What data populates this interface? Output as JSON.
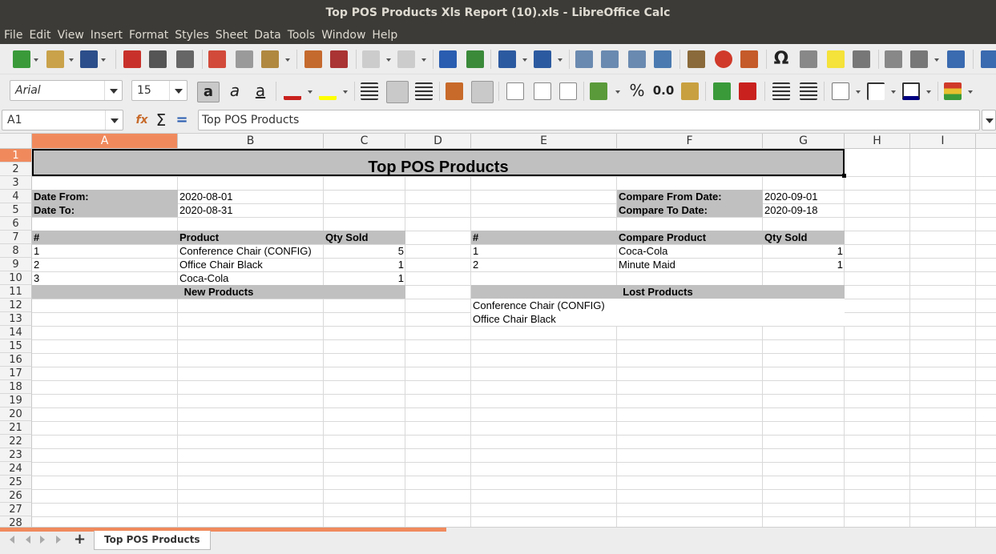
{
  "window": {
    "title": "Top POS Products Xls Report (10).xls - LibreOffice Calc"
  },
  "menu": [
    "File",
    "Edit",
    "View",
    "Insert",
    "Format",
    "Styles",
    "Sheet",
    "Data",
    "Tools",
    "Window",
    "Help"
  ],
  "toolbar": {
    "font_name": "Arial",
    "font_size": "15",
    "percent_label": "%",
    "decimal_label": "0.0"
  },
  "formula": {
    "cell_ref": "A1",
    "content": "Top POS Products"
  },
  "columns": [
    "A",
    "B",
    "C",
    "D",
    "E",
    "F",
    "G",
    "H",
    "I"
  ],
  "rows": [
    "1",
    "2",
    "3",
    "4",
    "5",
    "6",
    "7",
    "8",
    "9",
    "10",
    "11",
    "12",
    "13",
    "14",
    "15",
    "16",
    "17",
    "18",
    "19",
    "20",
    "21",
    "22",
    "23",
    "24",
    "25",
    "26",
    "27",
    "28"
  ],
  "report": {
    "title": "Top POS Products",
    "date_from_label": "Date From:",
    "date_from": "2020-08-01",
    "date_to_label": "Date To:",
    "date_to": "2020-08-31",
    "compare_from_label": "Compare From Date:",
    "compare_from": "2020-09-01",
    "compare_to_label": "Compare To Date:",
    "compare_to": "2020-09-18",
    "left_headers": [
      "#",
      "Product",
      "Qty Sold"
    ],
    "left_rows": [
      [
        "1",
        "Conference Chair (CONFIG)",
        "5"
      ],
      [
        "2",
        "Office Chair Black",
        "1"
      ],
      [
        "3",
        "Coca-Cola",
        "1"
      ]
    ],
    "right_headers": [
      "#",
      "Compare Product",
      "Qty Sold"
    ],
    "right_rows": [
      [
        "1",
        "Coca-Cola",
        "1"
      ],
      [
        "2",
        "Minute Maid",
        "1"
      ]
    ],
    "new_products_label": "New Products",
    "lost_products_label": "Lost Products",
    "lost_products": [
      "Conference Chair (CONFIG)",
      "Office Chair Black"
    ]
  },
  "sheet_tab": {
    "name": "Top POS Products"
  }
}
